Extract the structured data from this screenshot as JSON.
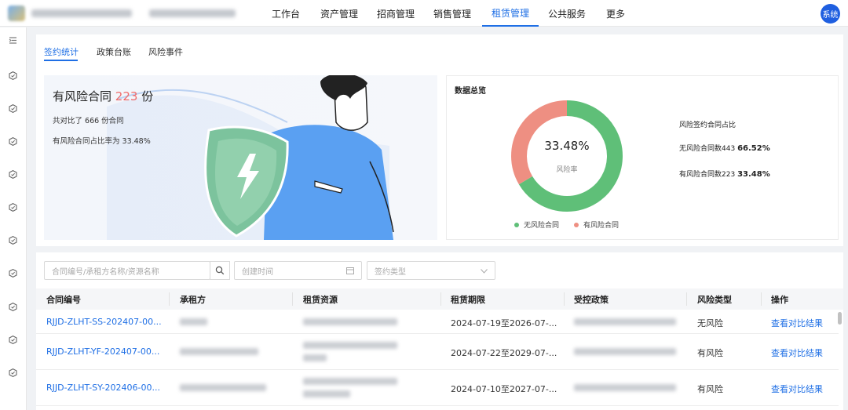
{
  "topnav": {
    "items": [
      "工作台",
      "资产管理",
      "招商管理",
      "销售管理",
      "租赁管理",
      "公共服务",
      "更多"
    ],
    "active": "租赁管理",
    "user_label": "系统"
  },
  "tabs": {
    "items": [
      "签约统计",
      "政策台账",
      "风险事件"
    ],
    "active": "签约统计"
  },
  "summary": {
    "title_prefix": "有风险合同",
    "risk_count": "223",
    "title_suffix": "份",
    "total_text": "共对比了 666 份合同",
    "ratio_text": "有风险合同占比率为 33.48%"
  },
  "overview": {
    "title": "数据总览",
    "center_value": "33.48%",
    "center_label": "风险率",
    "legend": [
      "无风险合同",
      "有风险合同"
    ],
    "stats_heading": "风险签约合同占比",
    "no_risk_label": "无风险合同数443",
    "no_risk_pct": "66.52%",
    "risk_label": "有风险合同数223",
    "risk_pct": "33.48%",
    "colors": {
      "no_risk": "#5fbf78",
      "risk": "#ee8f82"
    }
  },
  "chart_data": {
    "type": "pie",
    "categories": [
      "无风险合同",
      "有风险合同"
    ],
    "values": [
      443,
      223
    ],
    "percent": [
      66.52,
      33.48
    ],
    "title": "数据总览"
  },
  "filters": {
    "search_placeholder": "合同编号/承租方名称/资源名称",
    "date_placeholder": "创建时间",
    "type_placeholder": "签约类型"
  },
  "table": {
    "headers": [
      "合同编号",
      "承租方",
      "租赁资源",
      "租赁期限",
      "受控政策",
      "风险类型",
      "操作"
    ],
    "rows": [
      {
        "id": "RJJD-ZLHT-SS-202407-00...",
        "term": "2024-07-19至2026-07-...",
        "risk": "无风险",
        "action": "查看对比结果"
      },
      {
        "id": "RJJD-ZLHT-YF-202407-00...",
        "term": "2024-07-22至2029-07-...",
        "risk": "有风险",
        "action": "查看对比结果"
      },
      {
        "id": "RJJD-ZLHT-SY-202406-00...",
        "term": "2024-07-10至2027-07-...",
        "risk": "有风险",
        "action": "查看对比结果"
      }
    ]
  }
}
